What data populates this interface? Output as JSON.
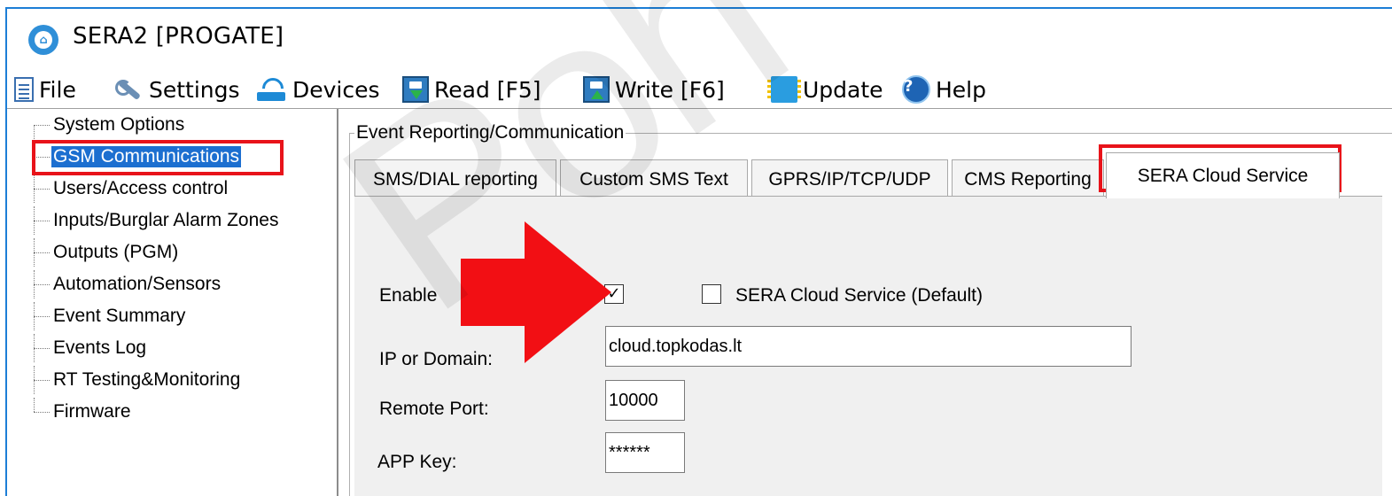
{
  "window": {
    "title": "SERA2 [PROGATE]"
  },
  "menu": {
    "file": "File",
    "settings": "Settings",
    "devices": "Devices",
    "read": "Read [F5]",
    "write": "Write [F6]",
    "update": "Update",
    "help": "Help"
  },
  "tree": {
    "items": [
      "System Options",
      "GSM Communications",
      "Users/Access control",
      "Inputs/Burglar Alarm Zones",
      "Outputs (PGM)",
      "Automation/Sensors",
      "Event Summary",
      "Events Log",
      "RT Testing&Monitoring",
      "Firmware"
    ],
    "selected": "GSM Communications"
  },
  "group": {
    "title": "Event Reporting/Communication"
  },
  "tabs": [
    "SMS/DIAL reporting",
    "Custom SMS Text",
    "GPRS/IP/TCP/UDP",
    "CMS Reporting",
    "SERA Cloud Service"
  ],
  "active_tab": "SERA Cloud Service",
  "form": {
    "enable_label": "Enable",
    "enable_checked": true,
    "default_label": "SERA Cloud Service (Default)",
    "default_checked": false,
    "ip_label": "IP or Domain:",
    "ip_value": "cloud.topkodas.lt",
    "port_label": "Remote Port:",
    "port_value": "10000",
    "appkey_label": "APP Key:",
    "appkey_value": "******"
  },
  "watermark": "Poh",
  "colors": {
    "highlight": "#e8131a",
    "selection": "#1c6fd0",
    "window_border": "#1c7ed6"
  }
}
